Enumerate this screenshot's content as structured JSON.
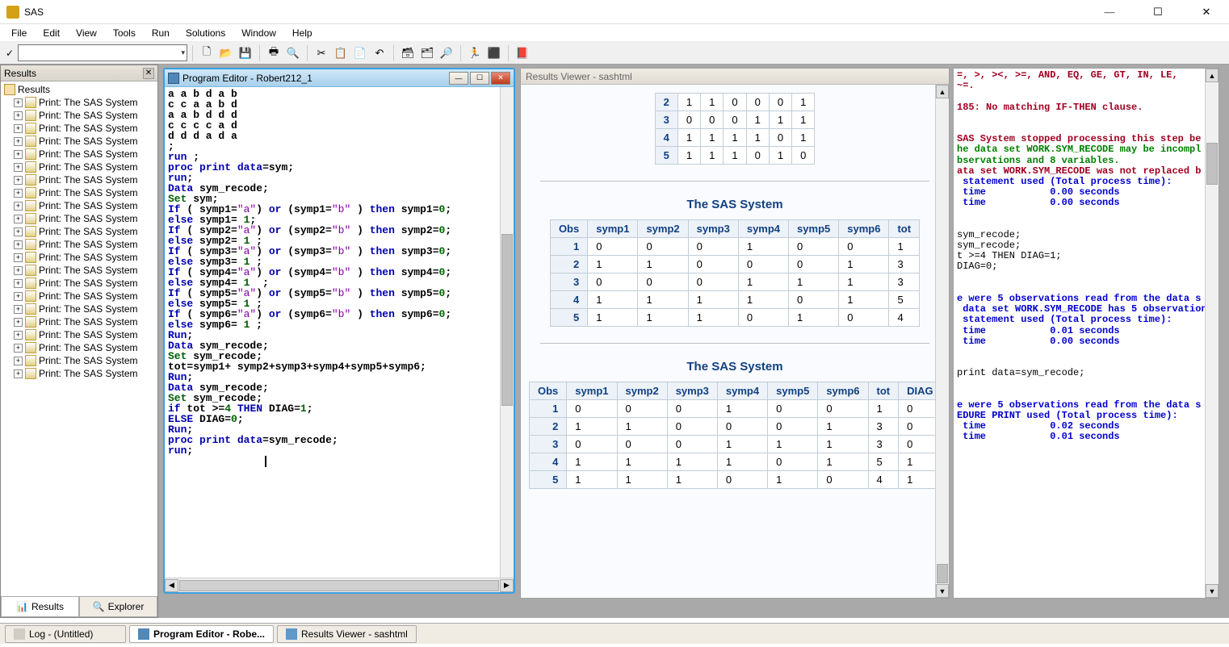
{
  "app": {
    "title": "SAS"
  },
  "menu": [
    "File",
    "Edit",
    "View",
    "Tools",
    "Run",
    "Solutions",
    "Window",
    "Help"
  ],
  "toolbar_icons": [
    "new",
    "open",
    "save",
    "|",
    "print",
    "preview",
    "|",
    "cut",
    "copy",
    "paste",
    "undo",
    "|",
    "library",
    "explorer",
    "find",
    "|",
    "run",
    "stop",
    "|",
    "help"
  ],
  "results_panel": {
    "title": "Results",
    "root": "Results",
    "items": [
      "Print: The SAS System",
      "Print: The SAS System",
      "Print: The SAS System",
      "Print: The SAS System",
      "Print: The SAS System",
      "Print: The SAS System",
      "Print: The SAS System",
      "Print: The SAS System",
      "Print: The SAS System",
      "Print: The SAS System",
      "Print: The SAS System",
      "Print: The SAS System",
      "Print: The SAS System",
      "Print: The SAS System",
      "Print: The SAS System",
      "Print: The SAS System",
      "Print: The SAS System",
      "Print: The SAS System",
      "Print: The SAS System",
      "Print: The SAS System",
      "Print: The SAS System",
      "Print: The SAS System"
    ],
    "tabs": {
      "results": "Results",
      "explorer": "Explorer"
    }
  },
  "editor": {
    "title": "Program Editor - Robert212_1",
    "code_lines": [
      {
        "t": "plain",
        "s": "a a b d a b"
      },
      {
        "t": "plain",
        "s": "c c a a b d"
      },
      {
        "t": "plain",
        "s": "a a b d d d"
      },
      {
        "t": "plain",
        "s": "c c c c a d"
      },
      {
        "t": "plain",
        "s": "d d d a d a"
      },
      {
        "t": "plain",
        "s": ";"
      },
      {
        "t": "mix",
        "s": [
          [
            "kw",
            "run"
          ],
          [
            "plain",
            " ;"
          ]
        ]
      },
      {
        "t": "plain",
        "s": ""
      },
      {
        "t": "mix",
        "s": [
          [
            "kw",
            "proc"
          ],
          [
            "plain",
            " "
          ],
          [
            "kw",
            "print"
          ],
          [
            "plain",
            " "
          ],
          [
            "kw",
            "data"
          ],
          [
            "plain",
            "=sym;"
          ]
        ]
      },
      {
        "t": "mix",
        "s": [
          [
            "kw",
            "run"
          ],
          [
            "plain",
            ";"
          ]
        ]
      },
      {
        "t": "plain",
        "s": ""
      },
      {
        "t": "mix",
        "s": [
          [
            "kw",
            "Data"
          ],
          [
            "plain",
            " sym_recode;"
          ]
        ]
      },
      {
        "t": "mix",
        "s": [
          [
            "ds",
            "Set"
          ],
          [
            "plain",
            " sym;"
          ]
        ]
      },
      {
        "t": "mix",
        "s": [
          [
            "kw",
            "If"
          ],
          [
            "plain",
            " ( symp1="
          ],
          [
            "str",
            "\"a\""
          ],
          [
            "plain",
            ") "
          ],
          [
            "kw",
            "or"
          ],
          [
            "plain",
            " (symp1="
          ],
          [
            "str",
            "\"b\""
          ],
          [
            "plain",
            " ) "
          ],
          [
            "kw",
            "then"
          ],
          [
            "plain",
            " symp1="
          ],
          [
            "ds",
            "0"
          ],
          [
            "plain",
            ";"
          ]
        ]
      },
      {
        "t": "mix",
        "s": [
          [
            "kw",
            "else"
          ],
          [
            "plain",
            " symp1= "
          ],
          [
            "ds",
            "1"
          ],
          [
            "plain",
            ";"
          ]
        ]
      },
      {
        "t": "mix",
        "s": [
          [
            "kw",
            "If"
          ],
          [
            "plain",
            " ( symp2="
          ],
          [
            "str",
            "\"a\""
          ],
          [
            "plain",
            ") "
          ],
          [
            "kw",
            "or"
          ],
          [
            "plain",
            " (symp2="
          ],
          [
            "str",
            "\"b\""
          ],
          [
            "plain",
            " ) "
          ],
          [
            "kw",
            "then"
          ],
          [
            "plain",
            " symp2="
          ],
          [
            "ds",
            "0"
          ],
          [
            "plain",
            ";"
          ]
        ]
      },
      {
        "t": "mix",
        "s": [
          [
            "kw",
            "else"
          ],
          [
            "plain",
            " symp2= "
          ],
          [
            "ds",
            "1"
          ],
          [
            "plain",
            " ;"
          ]
        ]
      },
      {
        "t": "mix",
        "s": [
          [
            "kw",
            "If"
          ],
          [
            "plain",
            " ( symp3="
          ],
          [
            "str",
            "\"a\""
          ],
          [
            "plain",
            ") "
          ],
          [
            "kw",
            "or"
          ],
          [
            "plain",
            " (symp3="
          ],
          [
            "str",
            "\"b\""
          ],
          [
            "plain",
            " ) "
          ],
          [
            "kw",
            "then"
          ],
          [
            "plain",
            " symp3="
          ],
          [
            "ds",
            "0"
          ],
          [
            "plain",
            ";"
          ]
        ]
      },
      {
        "t": "mix",
        "s": [
          [
            "kw",
            "else"
          ],
          [
            "plain",
            " symp3= "
          ],
          [
            "ds",
            "1"
          ],
          [
            "plain",
            " ;"
          ]
        ]
      },
      {
        "t": "mix",
        "s": [
          [
            "kw",
            "If"
          ],
          [
            "plain",
            " ( symp4="
          ],
          [
            "str",
            "\"a\""
          ],
          [
            "plain",
            ") "
          ],
          [
            "kw",
            "or"
          ],
          [
            "plain",
            " (symp4="
          ],
          [
            "str",
            "\"b\""
          ],
          [
            "plain",
            " ) "
          ],
          [
            "kw",
            "then"
          ],
          [
            "plain",
            " symp4="
          ],
          [
            "ds",
            "0"
          ],
          [
            "plain",
            ";"
          ]
        ]
      },
      {
        "t": "mix",
        "s": [
          [
            "kw",
            "else"
          ],
          [
            "plain",
            " symp4= "
          ],
          [
            "ds",
            "1"
          ],
          [
            "plain",
            "  ;"
          ]
        ]
      },
      {
        "t": "mix",
        "s": [
          [
            "kw",
            "If"
          ],
          [
            "plain",
            " ( symp5="
          ],
          [
            "str",
            "\"a\""
          ],
          [
            "plain",
            ") "
          ],
          [
            "kw",
            "or"
          ],
          [
            "plain",
            " (symp5="
          ],
          [
            "str",
            "\"b\""
          ],
          [
            "plain",
            " ) "
          ],
          [
            "kw",
            "then"
          ],
          [
            "plain",
            " symp5="
          ],
          [
            "ds",
            "0"
          ],
          [
            "plain",
            ";"
          ]
        ]
      },
      {
        "t": "mix",
        "s": [
          [
            "kw",
            "else"
          ],
          [
            "plain",
            " symp5= "
          ],
          [
            "ds",
            "1"
          ],
          [
            "plain",
            " ;"
          ]
        ]
      },
      {
        "t": "mix",
        "s": [
          [
            "kw",
            "If"
          ],
          [
            "plain",
            " ( symp6="
          ],
          [
            "str",
            "\"a\""
          ],
          [
            "plain",
            ") "
          ],
          [
            "kw",
            "or"
          ],
          [
            "plain",
            " (symp6="
          ],
          [
            "str",
            "\"b\""
          ],
          [
            "plain",
            " ) "
          ],
          [
            "kw",
            "then"
          ],
          [
            "plain",
            " symp6="
          ],
          [
            "ds",
            "0"
          ],
          [
            "plain",
            ";"
          ]
        ]
      },
      {
        "t": "mix",
        "s": [
          [
            "kw",
            "else"
          ],
          [
            "plain",
            " symp6= "
          ],
          [
            "ds",
            "1"
          ],
          [
            "plain",
            " ;"
          ]
        ]
      },
      {
        "t": "mix",
        "s": [
          [
            "kw",
            "Run"
          ],
          [
            "plain",
            ";"
          ]
        ]
      },
      {
        "t": "plain",
        "s": ""
      },
      {
        "t": "mix",
        "s": [
          [
            "kw",
            "Data"
          ],
          [
            "plain",
            " sym_recode;"
          ]
        ]
      },
      {
        "t": "mix",
        "s": [
          [
            "ds",
            "Set"
          ],
          [
            "plain",
            " sym_recode;"
          ]
        ]
      },
      {
        "t": "plain",
        "s": "tot=symp1+ symp2+symp3+symp4+symp5+symp6;"
      },
      {
        "t": "mix",
        "s": [
          [
            "kw",
            "Run"
          ],
          [
            "plain",
            ";"
          ]
        ]
      },
      {
        "t": "plain",
        "s": ""
      },
      {
        "t": "mix",
        "s": [
          [
            "kw",
            "Data"
          ],
          [
            "plain",
            " sym_recode;"
          ]
        ]
      },
      {
        "t": "mix",
        "s": [
          [
            "ds",
            "Set"
          ],
          [
            "plain",
            " sym_recode;"
          ]
        ]
      },
      {
        "t": "mix",
        "s": [
          [
            "kw",
            "if"
          ],
          [
            "plain",
            " tot >="
          ],
          [
            "ds",
            "4"
          ],
          [
            "plain",
            " "
          ],
          [
            "kw",
            "THEN"
          ],
          [
            "plain",
            " DIAG="
          ],
          [
            "ds",
            "1"
          ],
          [
            "plain",
            ";"
          ]
        ]
      },
      {
        "t": "mix",
        "s": [
          [
            "kw",
            "ELSE"
          ],
          [
            "plain",
            " DIAG="
          ],
          [
            "ds",
            "0"
          ],
          [
            "plain",
            ";"
          ]
        ]
      },
      {
        "t": "mix",
        "s": [
          [
            "kw",
            "Run"
          ],
          [
            "plain",
            ";"
          ]
        ]
      },
      {
        "t": "plain",
        "s": ""
      },
      {
        "t": "plain",
        "s": ""
      },
      {
        "t": "mix",
        "s": [
          [
            "kw",
            "proc"
          ],
          [
            "plain",
            " "
          ],
          [
            "kw",
            "print"
          ],
          [
            "plain",
            " "
          ],
          [
            "kw",
            "data"
          ],
          [
            "plain",
            "=sym_recode;"
          ]
        ]
      },
      {
        "t": "mix",
        "s": [
          [
            "kw",
            "run"
          ],
          [
            "plain",
            ";"
          ]
        ]
      }
    ]
  },
  "viewer": {
    "title": "Results Viewer - sashtml",
    "heading": "The SAS System",
    "table1_partial": {
      "headers": [],
      "rows": [
        [
          "2",
          "1",
          "1",
          "0",
          "0",
          "0",
          "1"
        ],
        [
          "3",
          "0",
          "0",
          "0",
          "1",
          "1",
          "1"
        ],
        [
          "4",
          "1",
          "1",
          "1",
          "1",
          "0",
          "1"
        ],
        [
          "5",
          "1",
          "1",
          "1",
          "0",
          "1",
          "0"
        ]
      ]
    },
    "table2": {
      "headers": [
        "Obs",
        "symp1",
        "symp2",
        "symp3",
        "symp4",
        "symp5",
        "symp6",
        "tot"
      ],
      "rows": [
        [
          "1",
          "0",
          "0",
          "0",
          "1",
          "0",
          "0",
          "1"
        ],
        [
          "2",
          "1",
          "1",
          "0",
          "0",
          "0",
          "1",
          "3"
        ],
        [
          "3",
          "0",
          "0",
          "0",
          "1",
          "1",
          "1",
          "3"
        ],
        [
          "4",
          "1",
          "1",
          "1",
          "1",
          "0",
          "1",
          "5"
        ],
        [
          "5",
          "1",
          "1",
          "1",
          "0",
          "1",
          "0",
          "4"
        ]
      ]
    },
    "table3": {
      "headers": [
        "Obs",
        "symp1",
        "symp2",
        "symp3",
        "symp4",
        "symp5",
        "symp6",
        "tot",
        "DIAG"
      ],
      "rows": [
        [
          "1",
          "0",
          "0",
          "0",
          "1",
          "0",
          "0",
          "1",
          "0"
        ],
        [
          "2",
          "1",
          "1",
          "0",
          "0",
          "0",
          "1",
          "3",
          "0"
        ],
        [
          "3",
          "0",
          "0",
          "0",
          "1",
          "1",
          "1",
          "3",
          "0"
        ],
        [
          "4",
          "1",
          "1",
          "1",
          "1",
          "0",
          "1",
          "5",
          "1"
        ],
        [
          "5",
          "1",
          "1",
          "1",
          "0",
          "1",
          "0",
          "4",
          "1"
        ]
      ]
    }
  },
  "log": {
    "lines": [
      [
        "err",
        "=, >, ><, >=, AND, EQ, GE, GT, IN, LE,"
      ],
      [
        "err",
        "~=."
      ],
      [
        "plain",
        ""
      ],
      [
        "err",
        "185: No matching IF-THEN clause."
      ],
      [
        "plain",
        ""
      ],
      [
        "plain",
        ""
      ],
      [
        "err",
        "SAS System stopped processing this step be"
      ],
      [
        "warn",
        "he data set WORK.SYM_RECODE may be incompl"
      ],
      [
        "warn",
        "bservations and 8 variables."
      ],
      [
        "err",
        "ata set WORK.SYM_RECODE was not replaced b"
      ],
      [
        "note",
        " statement used (Total process time):"
      ],
      [
        "note",
        " time           0.00 seconds"
      ],
      [
        "note",
        " time           0.00 seconds"
      ],
      [
        "plain",
        ""
      ],
      [
        "plain",
        ""
      ],
      [
        "plain",
        "sym_recode;"
      ],
      [
        "plain",
        "sym_recode;"
      ],
      [
        "plain",
        "t >=4 THEN DIAG=1;"
      ],
      [
        "plain",
        "DIAG=0;"
      ],
      [
        "plain",
        ""
      ],
      [
        "plain",
        ""
      ],
      [
        "note",
        "e were 5 observations read from the data s"
      ],
      [
        "note",
        " data set WORK.SYM_RECODE has 5 observation"
      ],
      [
        "note",
        " statement used (Total process time):"
      ],
      [
        "note",
        " time           0.01 seconds"
      ],
      [
        "note",
        " time           0.00 seconds"
      ],
      [
        "plain",
        ""
      ],
      [
        "plain",
        ""
      ],
      [
        "plain",
        "print data=sym_recode;"
      ],
      [
        "plain",
        ""
      ],
      [
        "plain",
        ""
      ],
      [
        "note",
        "e were 5 observations read from the data s"
      ],
      [
        "note",
        "EDURE PRINT used (Total process time):"
      ],
      [
        "note",
        " time           0.02 seconds"
      ],
      [
        "note",
        " time           0.01 seconds"
      ]
    ]
  },
  "mdi_tabs": {
    "log": "Log - (Untitled)",
    "editor": "Program Editor - Robe...",
    "viewer": "Results Viewer - sashtml"
  }
}
